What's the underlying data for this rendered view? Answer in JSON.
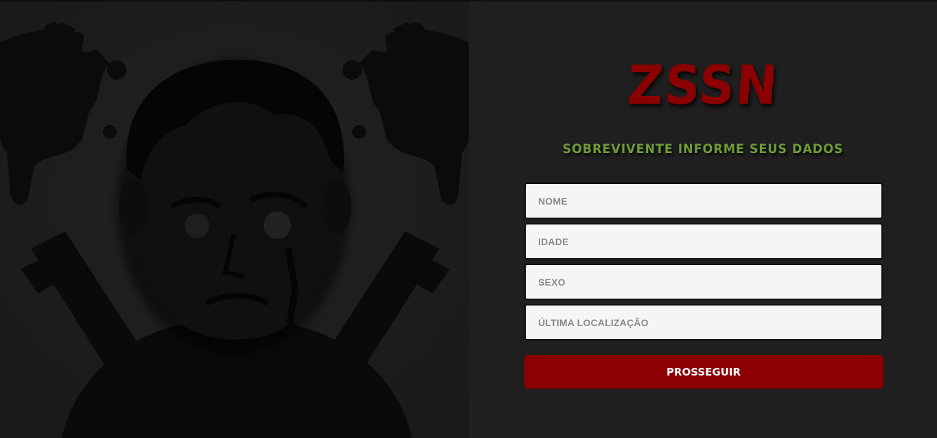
{
  "theme": {
    "background": "#1f1f1f",
    "accent_red": "#8b0000",
    "accent_green": "#6e9b36",
    "field_background": "#f5f5f5"
  },
  "hero": {
    "illustration": "zombie-survivor-skull-crossbones-illustration"
  },
  "brand": {
    "logo_text": "ZSSN"
  },
  "form": {
    "heading": "SOBREVIVENTE INFORME SEUS DADOS",
    "fields": [
      {
        "placeholder": "NOME",
        "value": ""
      },
      {
        "placeholder": "IDADE",
        "value": ""
      },
      {
        "placeholder": "SEXO",
        "value": ""
      },
      {
        "placeholder": "ÚLTIMA LOCALIZAÇÃO",
        "value": ""
      }
    ],
    "submit_label": "PROSSEGUIR"
  }
}
